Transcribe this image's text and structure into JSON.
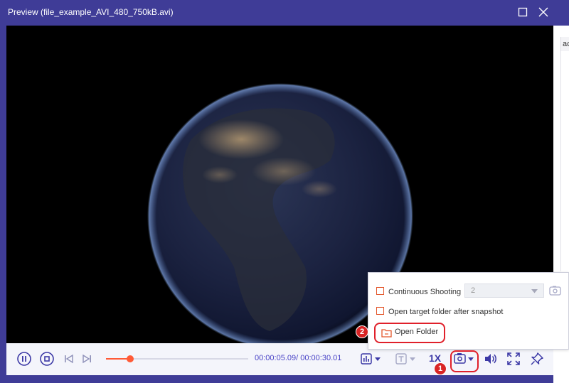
{
  "window": {
    "title": "Preview (file_example_AVI_480_750kB.avi)"
  },
  "side_panel": {
    "partial_text": "ac"
  },
  "player": {
    "current_time": "00:00:05.09",
    "separator": "/ ",
    "total_time": "00:00:30.01",
    "progress_fraction": 0.17,
    "speed_label": "1X"
  },
  "snapshot_menu": {
    "continuous_shooting_label": "Continuous Shooting",
    "continuous_count": "2",
    "open_target_label": "Open target folder after snapshot",
    "open_folder_label": "Open Folder"
  },
  "annotations": {
    "step1": "1",
    "step2": "2"
  },
  "colors": {
    "frame": "#3f3c97",
    "accent": "#4a44c7",
    "progress": "#ff5a36",
    "checkbox": "#e3562a",
    "highlight": "#e0202a"
  },
  "icons": [
    "maximize-icon",
    "close-icon",
    "pause-icon",
    "stop-icon",
    "previous-frame-icon",
    "next-frame-icon",
    "equalizer-icon",
    "subtitle-icon",
    "camera-icon",
    "volume-icon",
    "fullscreen-icon",
    "pin-icon",
    "folder-icon"
  ]
}
